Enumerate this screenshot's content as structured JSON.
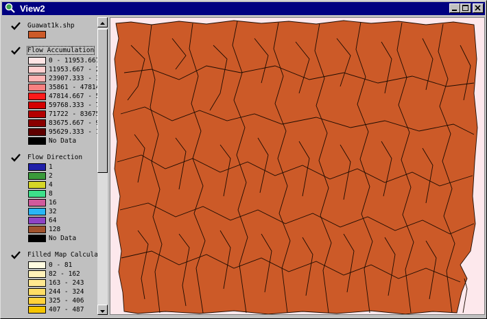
{
  "window": {
    "title": "View2"
  },
  "toc": {
    "themes": [
      {
        "name": "Guawat1k.shp",
        "legend": [
          {
            "color": "#cc5a28",
            "label": ""
          }
        ]
      },
      {
        "name": "Flow Accumulation",
        "legend": [
          {
            "color": "#ffe5e5",
            "label": "0 - 11953.667"
          },
          {
            "color": "#ffcfcf",
            "label": "11953.667 - 2"
          },
          {
            "color": "#ffb3b3",
            "label": "23907.333 - 3"
          },
          {
            "color": "#f98080",
            "label": "35861 - 47814"
          },
          {
            "color": "#ff1a1a",
            "label": "47814.667 - 5"
          },
          {
            "color": "#d40000",
            "label": "59768.333 - 7"
          },
          {
            "color": "#b30000",
            "label": "71722 - 83675"
          },
          {
            "color": "#8a0000",
            "label": "83675.667 - 9"
          },
          {
            "color": "#5f0000",
            "label": "95629.333 - 1"
          },
          {
            "color": "#000000",
            "label": "No Data"
          }
        ]
      },
      {
        "name": "Flow Direction",
        "legend": [
          {
            "color": "#1f1fa8",
            "label": "1"
          },
          {
            "color": "#3a9a3a",
            "label": "2"
          },
          {
            "color": "#d6d626",
            "label": "4"
          },
          {
            "color": "#3de08a",
            "label": "8"
          },
          {
            "color": "#d15a9c",
            "label": "16"
          },
          {
            "color": "#29b6f6",
            "label": "32"
          },
          {
            "color": "#8e44c4",
            "label": "64"
          },
          {
            "color": "#a0522d",
            "label": "128"
          },
          {
            "color": "#000000",
            "label": "No Data"
          }
        ]
      },
      {
        "name": "Filled Map Calculat",
        "legend": [
          {
            "color": "#fffbe0",
            "label": "0 - 81"
          },
          {
            "color": "#fff1b8",
            "label": "82 - 162"
          },
          {
            "color": "#ffe890",
            "label": "163 - 243"
          },
          {
            "color": "#ffdd66",
            "label": "244 - 324"
          },
          {
            "color": "#ffd23c",
            "label": "325 - 406"
          },
          {
            "color": "#f5c500",
            "label": "407 - 487"
          }
        ]
      }
    ]
  },
  "map": {
    "background": "#fde8ec",
    "fill": "#cc5a28",
    "stroke": "#1a0a00"
  }
}
